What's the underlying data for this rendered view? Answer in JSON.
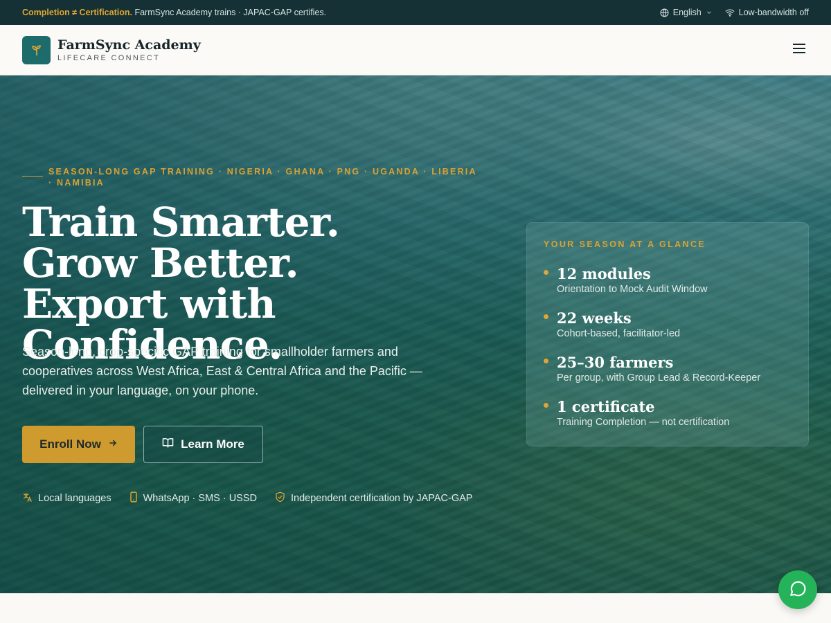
{
  "topbar": {
    "notice_highlight": "Completion ≠ Certification.",
    "notice_text": "FarmSync Academy trains · JAPAC-GAP certifies.",
    "language": "English",
    "bandwidth": "Low-bandwidth off"
  },
  "header": {
    "brand_name": "FarmSync Academy",
    "brand_sub": "LIFECARE CONNECT"
  },
  "hero": {
    "eyebrow": "SEASON-LONG GAP TRAINING · NIGERIA · GHANA · PNG · UGANDA · LIBERIA · NAMIBIA",
    "headline": "Train Smarter. Grow Better. Export with Confidence.",
    "subtitle": "Season-long, crop-specific GAP training for smallholder farmers and cooperatives across West Africa, East & Central Africa and the Pacific — delivered in your language, on your phone.",
    "enroll_label": "Enroll Now",
    "learn_label": "Learn More",
    "features": [
      {
        "icon": "translate-icon",
        "label": "Local languages"
      },
      {
        "icon": "phone-icon",
        "label": "WhatsApp · SMS · USSD"
      },
      {
        "icon": "shield-check-icon",
        "label": "Independent certification by JAPAC-GAP"
      }
    ]
  },
  "glance": {
    "title": "YOUR SEASON AT A GLANCE",
    "items": [
      {
        "value": "12 modules",
        "desc": "Orientation to Mock Audit Window"
      },
      {
        "value": "22 weeks",
        "desc": "Cohort-based, facilitator-led"
      },
      {
        "value": "25–30 farmers",
        "desc": "Per group, with Group Lead & Record-Keeper"
      },
      {
        "value": "1 certificate",
        "desc": "Training Completion — not certification"
      }
    ]
  },
  "colors": {
    "accent_gold": "#cf9a2e",
    "topbar_bg": "#153135",
    "brand_teal": "#1d6c6b",
    "chat_green": "#25b35a"
  }
}
